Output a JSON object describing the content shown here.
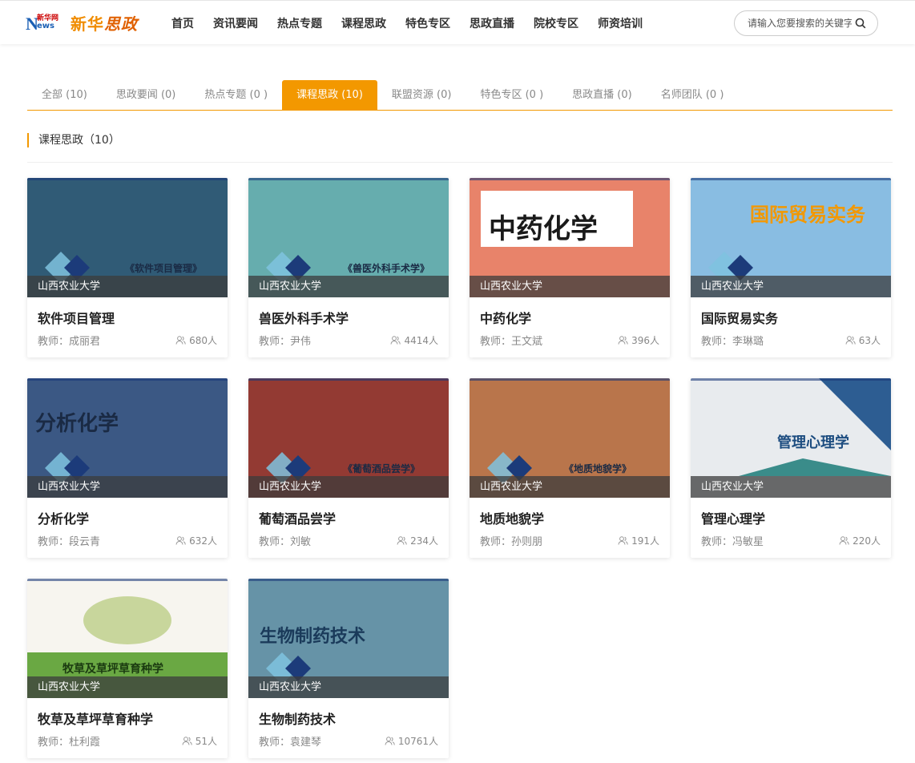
{
  "header": {
    "logo_news": "N",
    "logo_xinhua": "新华网",
    "logo_ews": "ews",
    "logo_brand": "新华",
    "logo_brand_accent": "思政",
    "nav": [
      "首页",
      "资讯要闻",
      "热点专题",
      "课程思政",
      "特色专区",
      "思政直播",
      "院校专区",
      "师资培训"
    ],
    "search_placeholder": "请输入您要搜索的关键字"
  },
  "tabs": [
    {
      "label": "全部 (10)",
      "active": false
    },
    {
      "label": "思政要闻 (0)",
      "active": false
    },
    {
      "label": "热点专题 (0 )",
      "active": false
    },
    {
      "label": "课程思政 (10)",
      "active": true
    },
    {
      "label": "联盟资源 (0)",
      "active": false
    },
    {
      "label": "特色专区 (0 )",
      "active": false
    },
    {
      "label": "思政直播 (0)",
      "active": false
    },
    {
      "label": "名师团队 (0 )",
      "active": false
    }
  ],
  "section_title": "课程思政（10）",
  "courses": [
    {
      "title": "软件项目管理",
      "school": "山西农业大学",
      "teacher": "教师：成丽君",
      "count": "680人",
      "thumb_text": "《软件项目管理》",
      "bg": "#1f4e6b"
    },
    {
      "title": "兽医外科手术学",
      "school": "山西农业大学",
      "teacher": "教师：尹伟",
      "count": "4414人",
      "thumb_text": "《兽医外科手术学》",
      "bg": "#5aa6a8"
    },
    {
      "title": "中药化学",
      "school": "山西农业大学",
      "teacher": "教师：王文斌",
      "count": "396人",
      "thumb_text": "中药化学",
      "bg": "#e8836a"
    },
    {
      "title": "国际贸易实务",
      "school": "山西农业大学",
      "teacher": "教师：李琳璐",
      "count": "63人",
      "thumb_text": "国际贸易实务",
      "bg": "#7fb8e0"
    },
    {
      "title": "分析化学",
      "school": "山西农业大学",
      "teacher": "教师：段云青",
      "count": "632人",
      "thumb_text": "分析化学",
      "bg": "#2b4a7a"
    },
    {
      "title": "葡萄酒品尝学",
      "school": "山西农业大学",
      "teacher": "教师：刘敏",
      "count": "234人",
      "thumb_text": "《葡萄酒品尝学》",
      "bg": "#8a2a22"
    },
    {
      "title": "地质地貌学",
      "school": "山西农业大学",
      "teacher": "教师：孙则朋",
      "count": "191人",
      "thumb_text": "《地质地貌学》",
      "bg": "#b36a3c"
    },
    {
      "title": "管理心理学",
      "school": "山西农业大学",
      "teacher": "教师：冯敏星",
      "count": "220人",
      "thumb_text": "管理心理学",
      "bg": "#e8ebee"
    },
    {
      "title": "牧草及草坪草育种学",
      "school": "山西农业大学",
      "teacher": "教师：杜利霞",
      "count": "51人",
      "thumb_text": "牧草及草坪草育种学",
      "bg": "#f7f5ef"
    },
    {
      "title": "生物制药技术",
      "school": "山西农业大学",
      "teacher": "教师：袁建琴",
      "count": "10761人",
      "thumb_text": "生物制药技术",
      "bg": "#5a8aa0"
    }
  ],
  "colors": {
    "accent": "#f39800"
  }
}
